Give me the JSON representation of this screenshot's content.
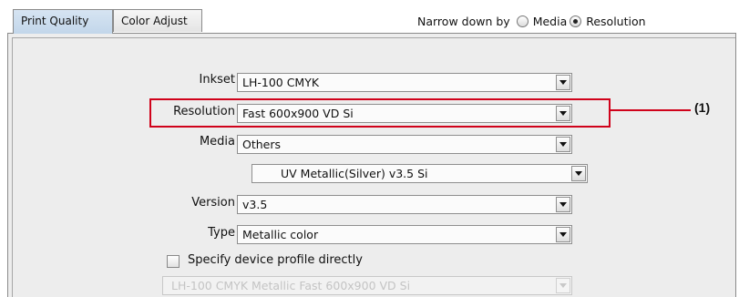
{
  "tabs": [
    {
      "label": "Print Quality",
      "active": true
    },
    {
      "label": "Color Adjust",
      "active": false
    }
  ],
  "narrow_down": {
    "label": "Narrow down by",
    "options": [
      {
        "label": "Media",
        "selected": false
      },
      {
        "label": "Resolution",
        "selected": true
      }
    ]
  },
  "fields": {
    "inkset": {
      "label": "Inkset",
      "value": "LH-100 CMYK"
    },
    "resolution": {
      "label": "Resolution",
      "value": "Fast 600x900 VD Si"
    },
    "media": {
      "label": "Media",
      "value": "Others"
    },
    "media_type": {
      "value": "UV Metallic(Silver) v3.5 Si"
    },
    "version": {
      "label": "Version",
      "value": "v3.5"
    },
    "type": {
      "label": "Type",
      "value": "Metallic color"
    }
  },
  "specify_profile": {
    "label": "Specify device profile directly",
    "checked": false
  },
  "profile_select": {
    "value": "LH-100 CMYK Metallic Fast 600x900 VD Si",
    "enabled": false
  },
  "callout": {
    "label": "(1)",
    "color": "#d0021b"
  }
}
